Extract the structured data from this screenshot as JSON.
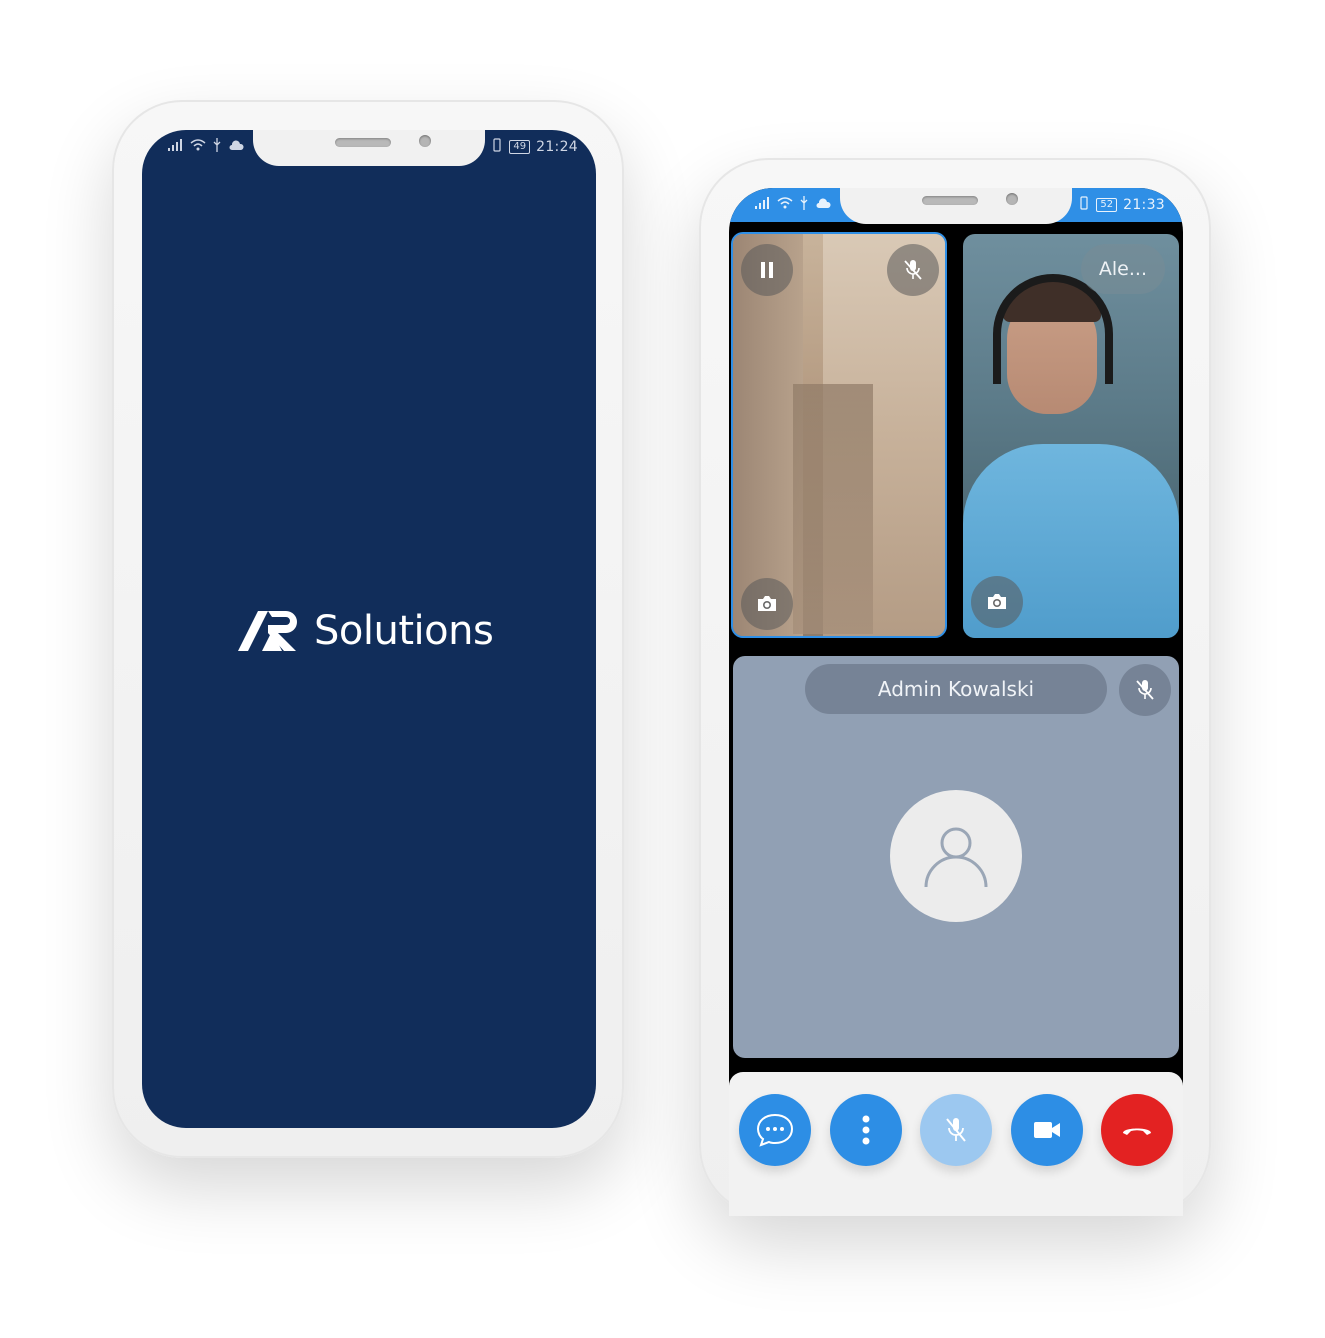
{
  "splash_phone": {
    "status": {
      "time": "21:24",
      "battery": "49"
    },
    "brand": {
      "logo_mark": "AR",
      "name": "Solutions"
    },
    "colors": {
      "background": "#112d5a",
      "text": "#ffffff"
    }
  },
  "call_phone": {
    "status": {
      "time": "21:33",
      "battery": "52"
    },
    "tiles": {
      "local": {
        "pause_icon": "pause-icon",
        "mute_icon": "mic-off-icon",
        "snapshot_icon": "camera-icon"
      },
      "remote": {
        "name": "Ale...",
        "snapshot_icon": "camera-icon"
      },
      "audio_only": {
        "name": "Admin Kowalski",
        "mute_icon": "mic-off-icon",
        "avatar_icon": "user-icon"
      }
    },
    "controls": [
      {
        "name": "chat",
        "icon": "chat-icon",
        "color": "#2d8ee5"
      },
      {
        "name": "more",
        "icon": "more-vertical-icon",
        "color": "#2d8ee5"
      },
      {
        "name": "mute",
        "icon": "mic-off-icon",
        "color": "#9cc8f0"
      },
      {
        "name": "video",
        "icon": "video-icon",
        "color": "#2d8ee5"
      },
      {
        "name": "hang-up",
        "icon": "hangup-icon",
        "color": "#e32222"
      }
    ],
    "colors": {
      "accent": "#2f8fe6",
      "audio_tile": "#91a0b4",
      "hangup": "#e32222"
    }
  }
}
